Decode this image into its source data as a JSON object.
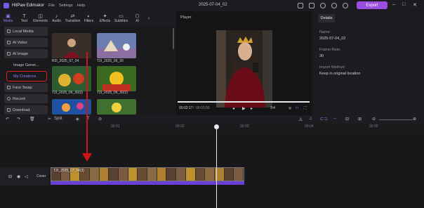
{
  "app": {
    "name": "HitPaw Edimakor",
    "menu": [
      "File",
      "Settings",
      "Help"
    ],
    "project": "2025-07-04_02",
    "export_label": "Export"
  },
  "toolbar": {
    "tools": [
      "Media",
      "Text",
      "Elements",
      "Audio",
      "Transition",
      "Filters",
      "Effects",
      "Subtitles",
      "Al"
    ]
  },
  "sidebar": {
    "items": [
      "Local Media",
      "AI Video",
      "AI Image",
      "Image Gener...",
      "My Creations",
      "Face Swap",
      "Record",
      "Download"
    ]
  },
  "media": {
    "items": [
      "R2I_2025_07_04",
      "T2I_2025_06_30",
      "T2I_2025_06_30(3)",
      "T2I_2025_06_30(2)"
    ]
  },
  "player": {
    "title": "Player",
    "current": "00:02:17",
    "total": "00:03:00",
    "ratio": "3:4",
    "progress": 1.0
  },
  "details": {
    "tab": "Details",
    "name_label": "Name:",
    "name_value": "2025-07-04_02",
    "fps_label": "Frame Rate:",
    "fps_value": "30",
    "import_label": "Import Method:",
    "import_value": "Keep in original location"
  },
  "timeline": {
    "split_label": "Split",
    "ticks": [
      "00:01",
      "00:02",
      "00:03",
      "00:04",
      "00:05"
    ],
    "track_label": "Cover",
    "clip_name": "T2I_2025_07_04(3)"
  },
  "colors": {
    "accent": "#8b7cf6",
    "export": "#9b4fe0",
    "annotation": "#d01515"
  }
}
